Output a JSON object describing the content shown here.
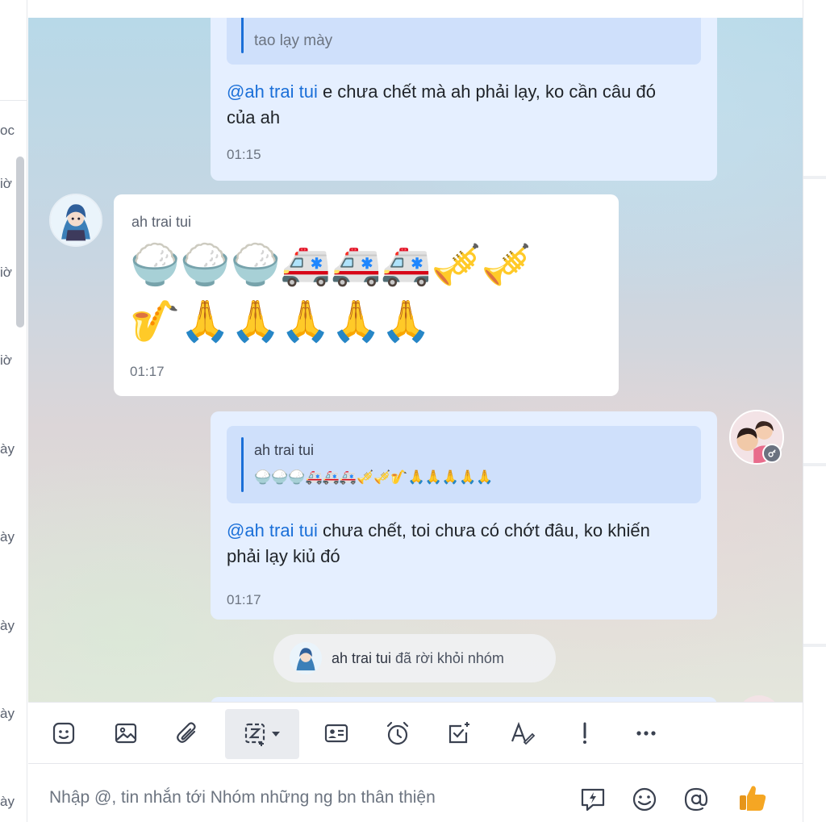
{
  "left_fragments": [
    "oc",
    "iờ",
    "iờ",
    "iờ",
    "ày",
    "ày",
    "ày",
    "ày",
    "ày"
  ],
  "messages": {
    "m1": {
      "quote_sender": "ah trai tui",
      "quote_text": "tao lạy mày",
      "mention": "@ah trai tui",
      "text_line1": " e chưa chết mà ah phải lạy, ko cần câu đó",
      "text_line2": "của ah",
      "time": "01:15"
    },
    "m2": {
      "sender": "ah trai tui",
      "emoji_line1": "🍚🍚🍚🚑🚑🚑🎺🎺",
      "emoji_line2": "🎷🙏🙏🙏🙏🙏",
      "time": "01:17"
    },
    "m3": {
      "quote_sender": "ah trai tui",
      "quote_emoji": "🍚🍚🍚🚑🚑🚑🎺🎺🎷🙏🙏🙏🙏🙏",
      "mention": "@ah trai tui",
      "text_line1": " chưa chết, toi chưa có chớt đâu, ko khiến",
      "text_line2": "phải lạy kiủ đó",
      "time": "01:17"
    }
  },
  "system_message": {
    "name": "ah trai tui",
    "text": " đã rời khỏi nhóm"
  },
  "toolbar": {
    "icons": [
      "sticker-icon",
      "image-icon",
      "attach-icon",
      "screenshot-icon",
      "contact-card-icon",
      "reminder-icon",
      "todo-icon",
      "text-format-icon",
      "important-icon",
      "more-icon"
    ]
  },
  "composer": {
    "placeholder": "Nhập @, tin nhắn tới Nhóm những ng bn thân thiện"
  },
  "colors": {
    "accent": "#1a6fd8",
    "my_bubble": "#e5efff",
    "quote_bg": "#cfe0fb",
    "like": "#f5a623"
  }
}
